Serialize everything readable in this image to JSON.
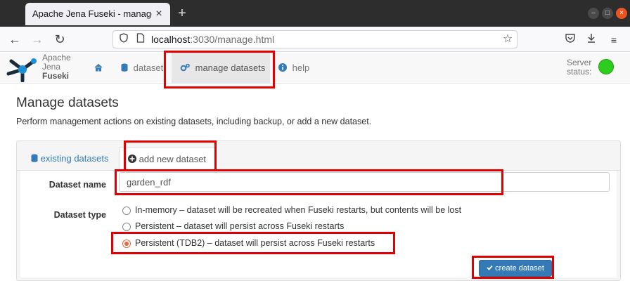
{
  "browser": {
    "tab_title": "Apache Jena Fuseki - manage",
    "tab_close_icon": "×",
    "new_tab_icon": "+",
    "url_host": "localhost",
    "url_rest": ":3030/manage.html"
  },
  "navbar": {
    "logo_line1": "Apache",
    "logo_line2": "Jena",
    "logo_line3": "Fuseki",
    "dataset_label": "dataset",
    "manage_label": "manage datasets",
    "help_label": "help",
    "server_status_line1": "Server",
    "server_status_line2": "status:"
  },
  "page": {
    "title": "Manage datasets",
    "description": "Perform management actions on existing datasets, including backup, or add a new dataset."
  },
  "tabs": {
    "existing_label": "existing datasets",
    "add_label": "add new dataset"
  },
  "form": {
    "name_label": "Dataset name",
    "name_value": "garden_rdf",
    "type_label": "Dataset type",
    "options": [
      {
        "label": "In-memory – dataset will be recreated when Fuseki restarts, but contents will be lost",
        "checked": false
      },
      {
        "label": "Persistent – dataset will persist across Fuseki restarts",
        "checked": false
      },
      {
        "label": "Persistent (TDB2) – dataset will persist across Fuseki restarts",
        "checked": true
      }
    ],
    "create_label": "create dataset"
  },
  "colors": {
    "link_blue": "#337ab7",
    "status_green": "#2ecc1f",
    "highlight_red": "#e00000",
    "radio_checked": "#e8663b"
  }
}
